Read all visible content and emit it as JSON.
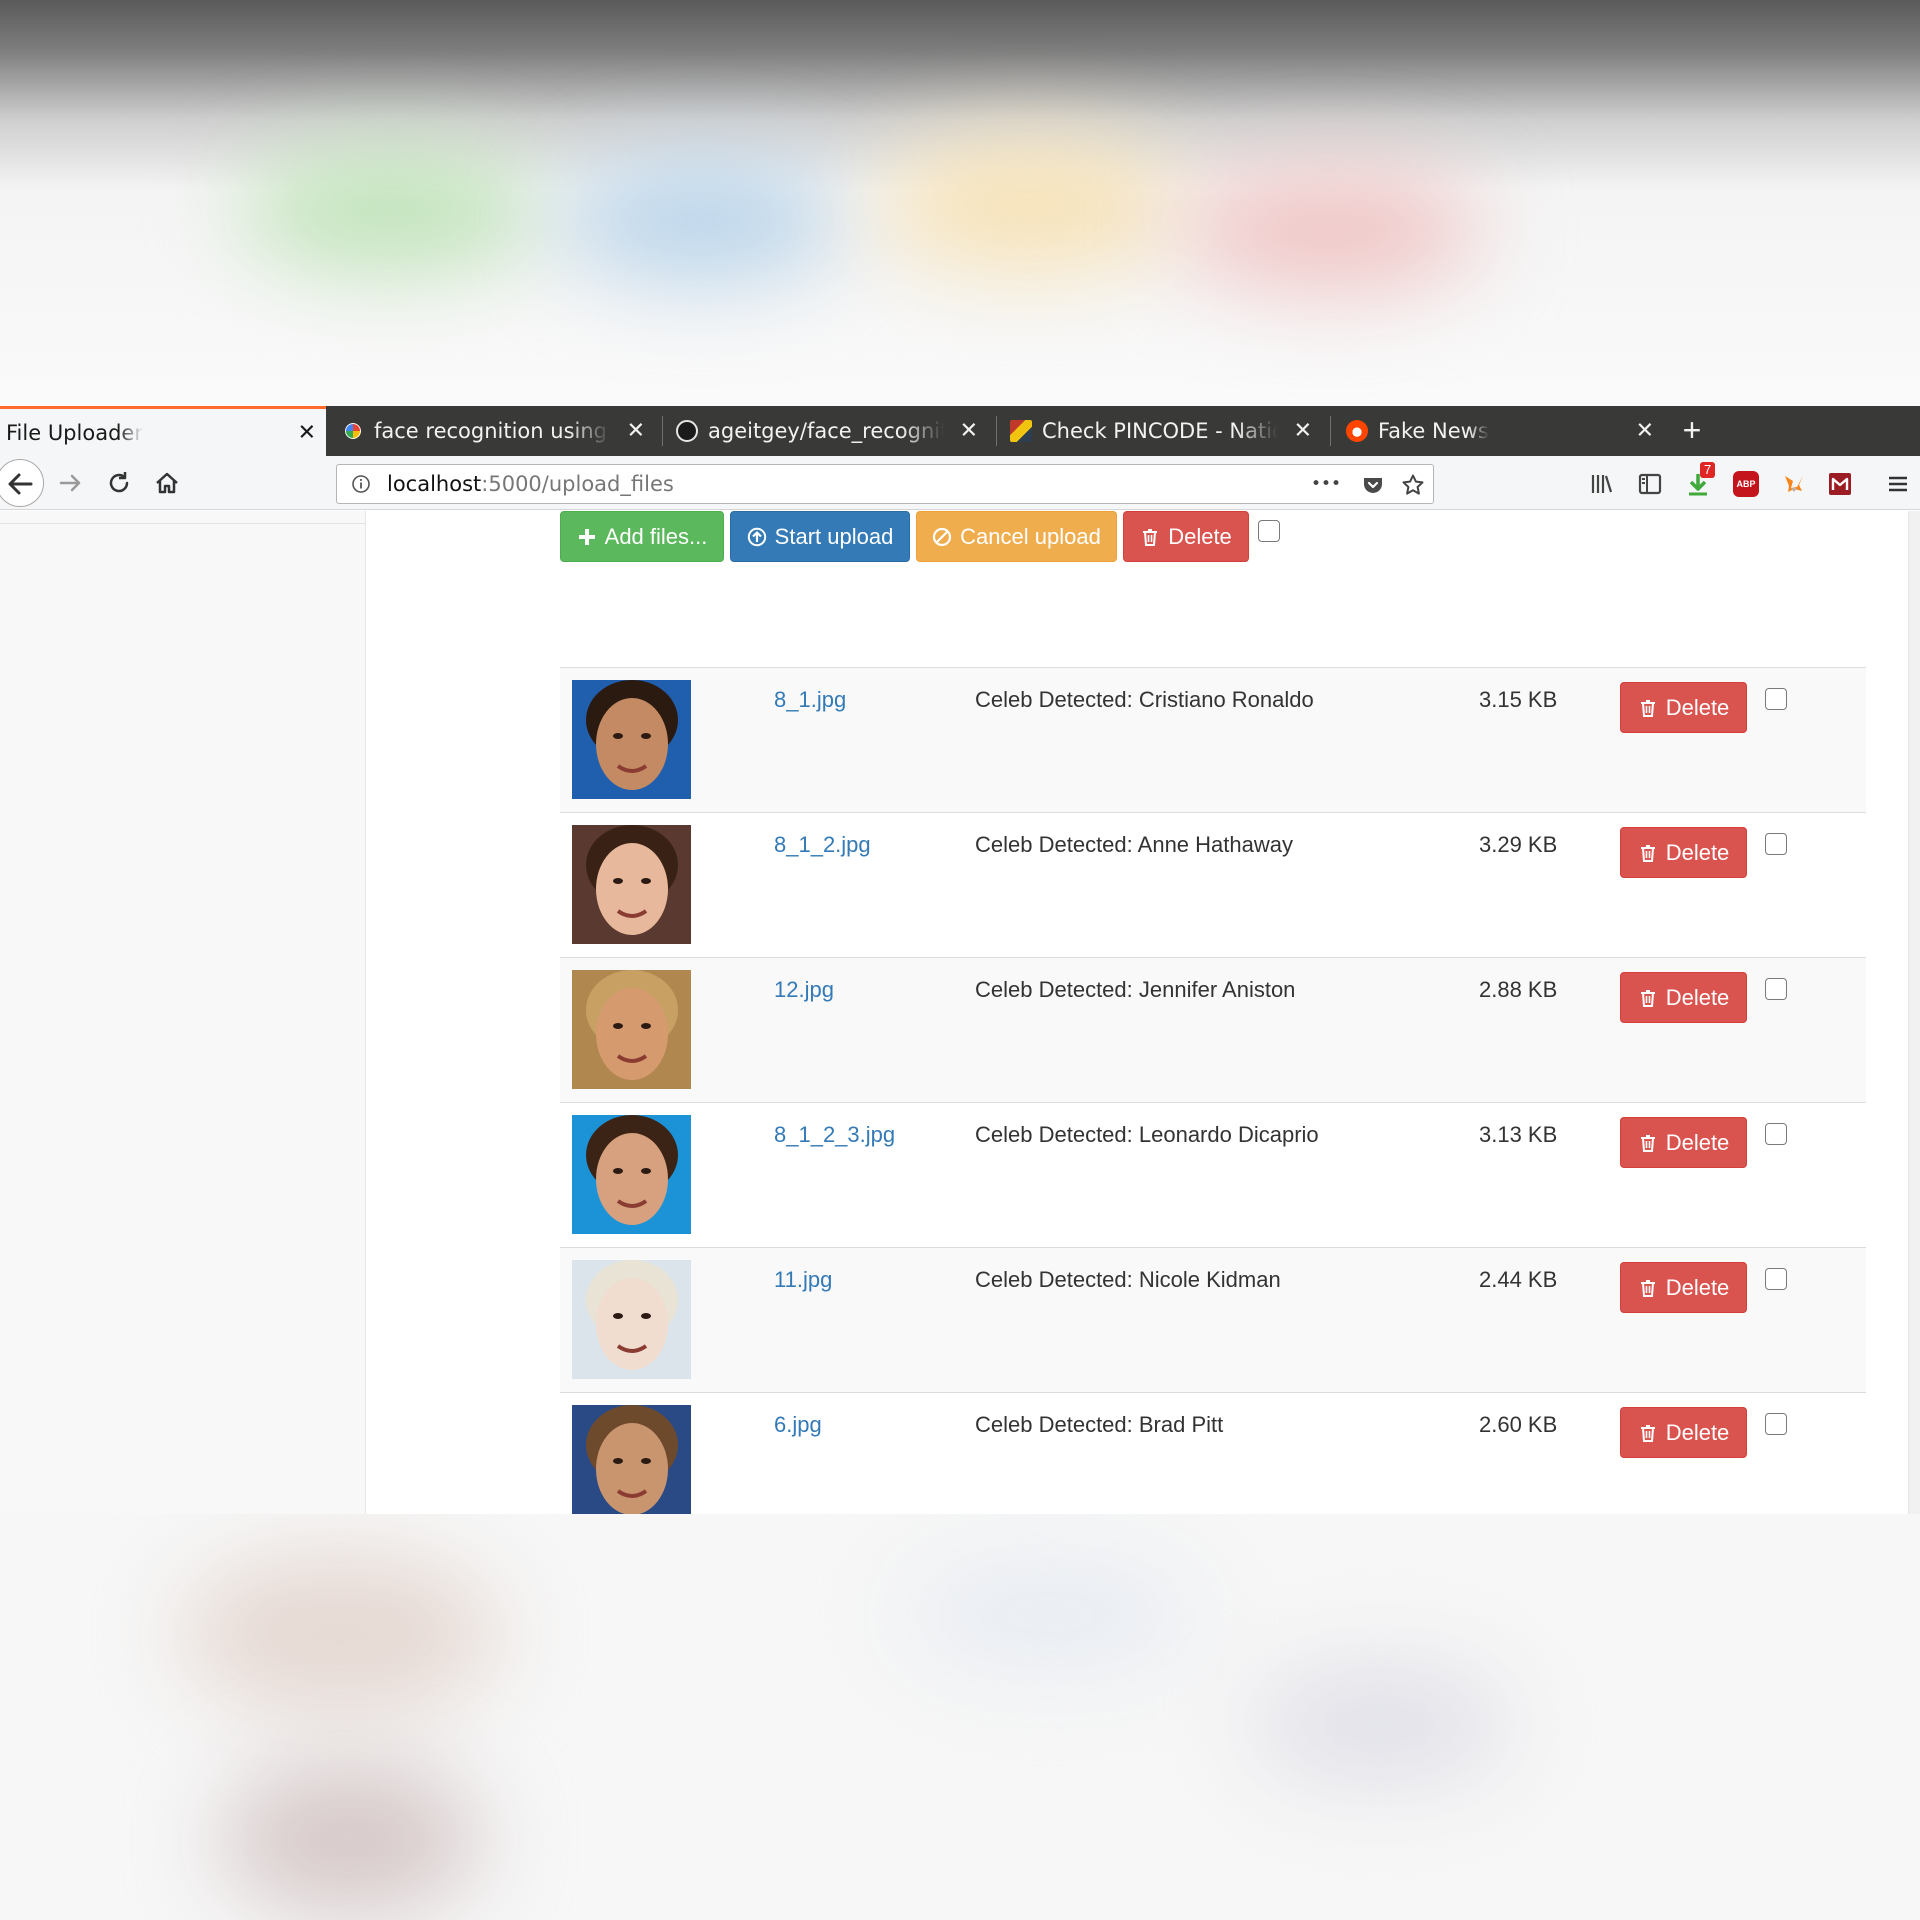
{
  "browser": {
    "tabs": [
      {
        "title": "File Uploader",
        "favicon": "none",
        "active": true
      },
      {
        "title": "face recognition using k",
        "favicon": "google-icon",
        "active": false
      },
      {
        "title": "ageitgey/face_recogniti",
        "favicon": "github-icon",
        "active": false
      },
      {
        "title": "Check PINCODE - Nation",
        "favicon": "india-post-icon",
        "active": false
      },
      {
        "title": "Fake News",
        "favicon": "reddit-icon",
        "active": false
      }
    ],
    "tab_close_glyph": "✕",
    "new_tab_glyph": "+",
    "url_host": "localhost",
    "url_path": ":5000/upload_files",
    "more_glyph": "•••",
    "download_badge": "7",
    "adblock_label": "ABP"
  },
  "toolbar": {
    "add_label": "Add files...",
    "start_label": "Start upload",
    "cancel_label": "Cancel upload",
    "delete_label": "Delete"
  },
  "files": [
    {
      "name": "8_1.jpg",
      "celeb": "Celeb Detected: Cristiano Ronaldo",
      "size": "3.15 KB",
      "delete_label": "Delete",
      "skin": "#c48a63",
      "hair": "#2a1a10",
      "bg": "#1f5fae"
    },
    {
      "name": "8_1_2.jpg",
      "celeb": "Celeb Detected: Anne Hathaway",
      "size": "3.29 KB",
      "delete_label": "Delete",
      "skin": "#e7b89c",
      "hair": "#3a2116",
      "bg": "#5a3a30"
    },
    {
      "name": "12.jpg",
      "celeb": "Celeb Detected: Jennifer Aniston",
      "size": "2.88 KB",
      "delete_label": "Delete",
      "skin": "#d59a6e",
      "hair": "#c9a064",
      "bg": "#b0874f"
    },
    {
      "name": "8_1_2_3.jpg",
      "celeb": "Celeb Detected: Leonardo Dicaprio",
      "size": "3.13 KB",
      "delete_label": "Delete",
      "skin": "#d7a07e",
      "hair": "#3b2416",
      "bg": "#1c93d6"
    },
    {
      "name": "11.jpg",
      "celeb": "Celeb Detected: Nicole Kidman",
      "size": "2.44 KB",
      "delete_label": "Delete",
      "skin": "#f1ddd0",
      "hair": "#e9e3d6",
      "bg": "#dbe4ea"
    },
    {
      "name": "6.jpg",
      "celeb": "Celeb Detected: Brad Pitt",
      "size": "2.60 KB",
      "delete_label": "Delete",
      "skin": "#c9956f",
      "hair": "#6e4a2c",
      "bg": "#2a4a86"
    }
  ],
  "colors": {
    "success": "#5cb85c",
    "primary": "#337ab7",
    "warning": "#f0ad4e",
    "danger": "#d9534f",
    "link": "#337ab7",
    "tab_accent": "#ff6a2c"
  }
}
